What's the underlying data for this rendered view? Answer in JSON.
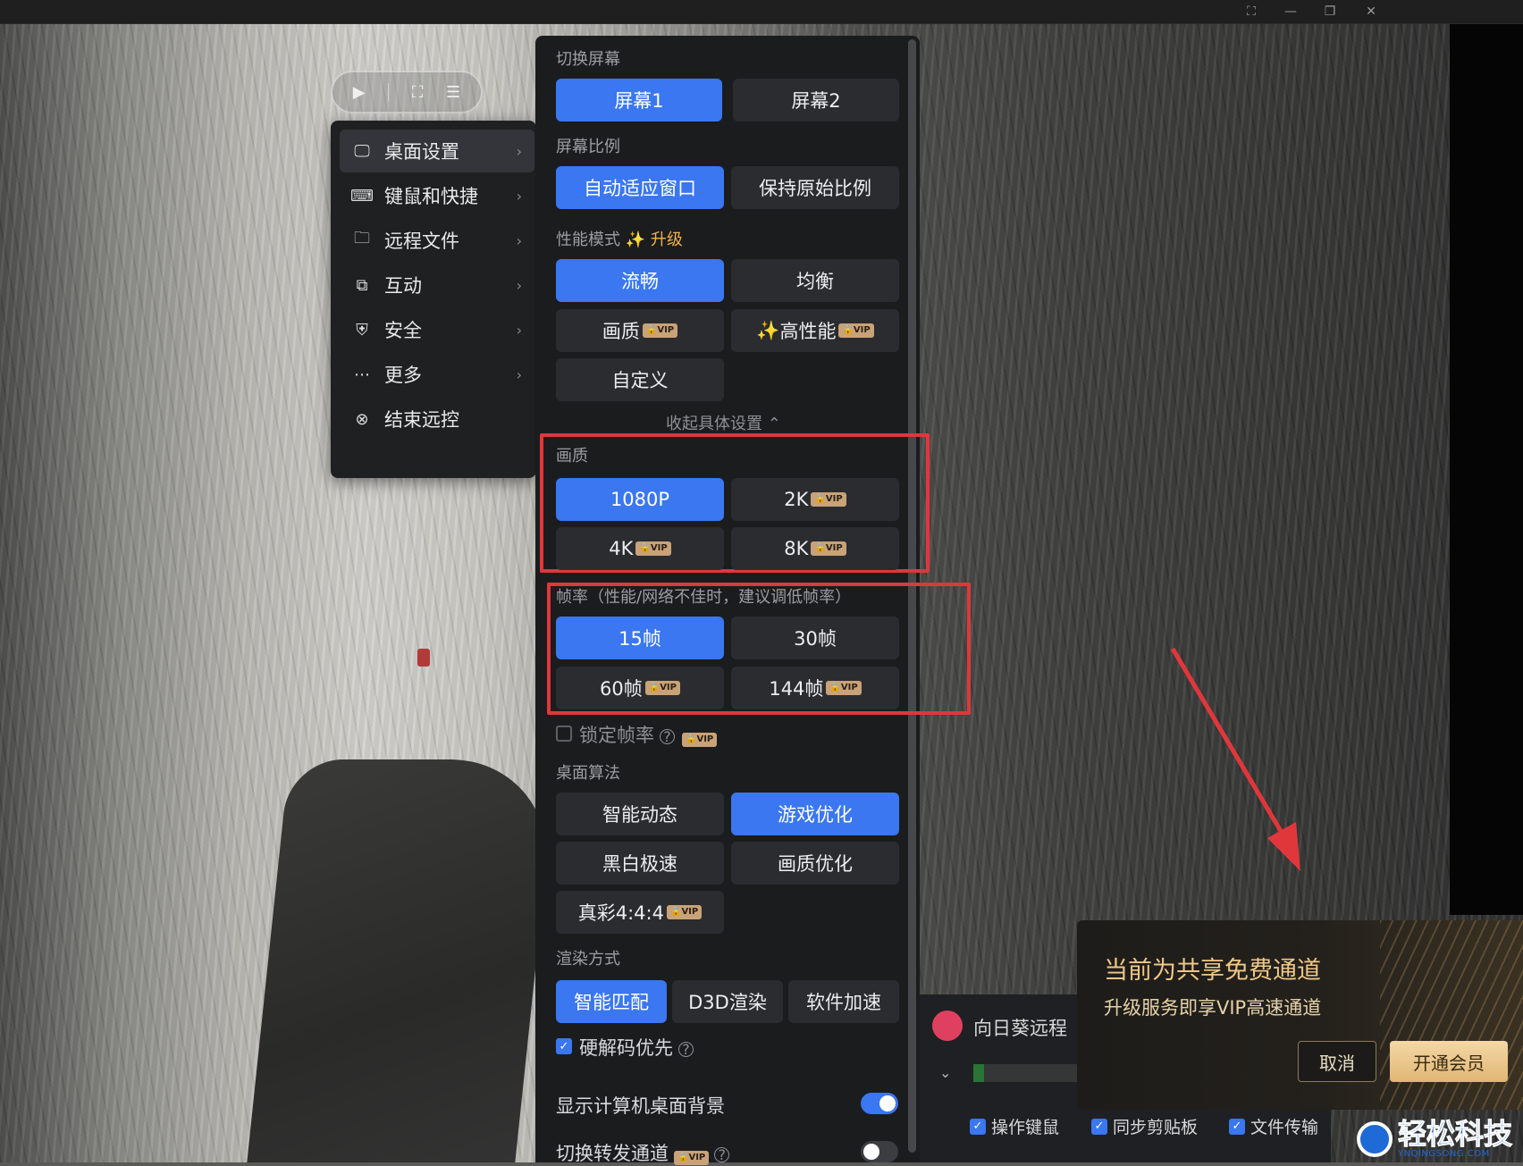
{
  "colors": {
    "accent": "#3a77f0",
    "vip_badge": "#c9a278",
    "redbox": "#e0373a",
    "popup_gold": "#f0c887"
  },
  "titlebar": {
    "icons": [
      "fullscreen-icon",
      "minimize-icon",
      "restore-icon",
      "close-icon"
    ],
    "glyphs": [
      "⛶",
      "—",
      "❐",
      "✕"
    ]
  },
  "pill": {
    "icons": [
      "play-icon",
      "fullscreen-icon",
      "settings-icon"
    ],
    "glyphs": [
      "▶",
      "⛶",
      "☰"
    ]
  },
  "menu": {
    "items": [
      {
        "label": "桌面设置",
        "icon": "monitor-icon",
        "glyph": "🖵"
      },
      {
        "label": "键鼠和快捷",
        "icon": "keyboard-icon",
        "glyph": "⌨"
      },
      {
        "label": "远程文件",
        "icon": "folder-icon",
        "glyph": "🗀"
      },
      {
        "label": "互动",
        "icon": "interact-icon",
        "glyph": "⧉"
      },
      {
        "label": "安全",
        "icon": "shield-icon",
        "glyph": "⛨"
      },
      {
        "label": "更多",
        "icon": "more-icon",
        "glyph": "⋯"
      },
      {
        "label": "结束远控",
        "icon": "close-circle-icon",
        "glyph": "⊗"
      }
    ],
    "chevron": "›"
  },
  "panel": {
    "switch_screen": {
      "label": "切换屏幕",
      "options": [
        "屏幕1",
        "屏幕2"
      ],
      "selected": "屏幕1"
    },
    "ratio": {
      "label": "屏幕比例",
      "options": [
        "自动适应窗口",
        "保持原始比例"
      ],
      "selected": "自动适应窗口"
    },
    "perf": {
      "label": "性能模式",
      "upgrade": "升级",
      "spark": "✨",
      "options": {
        "smooth": "流畅",
        "balance": "均衡",
        "quality": "画质",
        "high": "高性能",
        "custom": "自定义"
      },
      "selected": "流畅"
    },
    "collapse": "收起具体设置 ⌃",
    "quality": {
      "label": "画质",
      "options": [
        "1080P",
        "2K",
        "4K",
        "8K"
      ],
      "selected": "1080P"
    },
    "fps": {
      "label": "帧率（性能/网络不佳时，建议调低帧率）",
      "options": [
        "15帧",
        "30帧",
        "60帧",
        "144帧"
      ],
      "selected": "15帧"
    },
    "lock_fps": {
      "label": "锁定帧率",
      "checked": false
    },
    "algo": {
      "label": "桌面算法",
      "options": [
        "智能动态",
        "游戏优化",
        "黑白极速",
        "画质优化",
        "真彩4:4:4"
      ],
      "selected": "游戏优化"
    },
    "render": {
      "label": "渲染方式",
      "options": [
        "智能匹配",
        "D3D渲染",
        "软件加速"
      ],
      "selected": "智能匹配"
    },
    "hw_decode": {
      "label": "硬解码优先",
      "checked": true
    },
    "show_bg": {
      "label": "显示计算机桌面背景",
      "on": true
    },
    "relay": {
      "label": "切换转发通道",
      "on": false
    },
    "vip_text": "VIP",
    "help_glyph": "?",
    "check_glyph": "✓"
  },
  "mini_window": {
    "title": "向日葵远程",
    "checks": [
      "操作键鼠",
      "同步剪贴板",
      "文件传输"
    ],
    "chevron": "⌄"
  },
  "popup": {
    "title": "当前为共享免费通道",
    "subtitle": "升级服务即享VIP高速通道",
    "cancel": "取消",
    "open": "开通会员"
  },
  "watermark": {
    "name": "轻松科技",
    "url": "YNQINGSONG.COM"
  }
}
